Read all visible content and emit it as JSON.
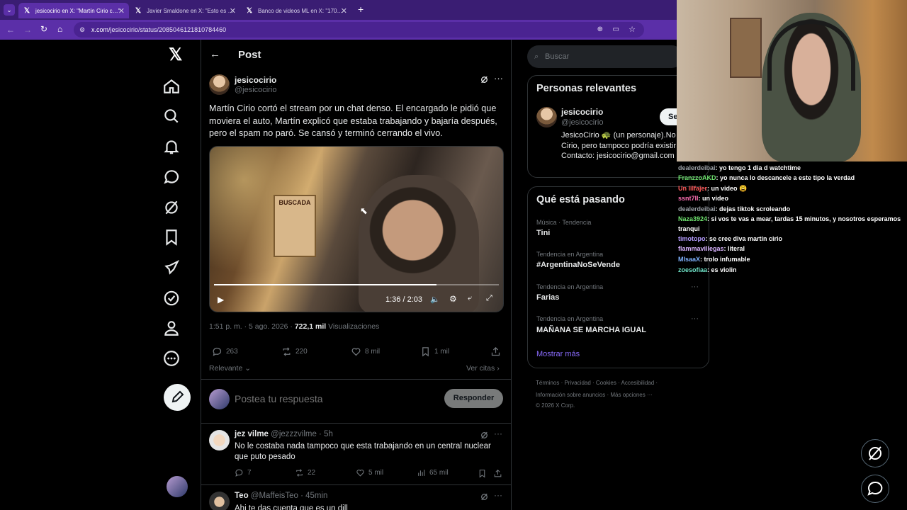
{
  "browser": {
    "tabs": [
      {
        "label": "jesicocirio en X: \"Martín Cirio c…\"",
        "active": true
      },
      {
        "label": "Javier Smaldone en X: \"Esto es …",
        "active": false
      },
      {
        "label": "Banco de videos ML en X: \"170…",
        "active": false
      }
    ],
    "url_host": "x.com",
    "url_path": "/jesicocirio/status/2085046121810784460"
  },
  "post": {
    "header_title": "Post",
    "author_name": "jesicocirio",
    "author_handle": "@jesicocirio",
    "text": "Martín Cirio cortó el stream por un chat denso. El encargado le pidió que moviera el auto, Martín explicó que estaba trabajando y bajaría después, pero el spam no paró. Se cansó y terminó cerrando el vivo.",
    "video_time": "1:36 / 2:03",
    "video_progress": 0.78,
    "video_sign": "BUSCADA",
    "meta_time": "1:51 p. m. · 5 ago. 2026 · ",
    "views_count": "722,1 mil",
    "views_label": " Visualizaciones",
    "replies": "263",
    "reposts": "220",
    "likes": "8 mil",
    "bookmarks": "1 mil",
    "sort_label": "Relevante",
    "quotes_link": "Ver citas",
    "reply_placeholder": "Postea tu respuesta",
    "reply_button": "Responder"
  },
  "replies": [
    {
      "name": "jez vilme",
      "handle": "@jezzzvilme · 5h",
      "text": "No le costaba nada tampoco que esta trabajando en un central nuclear que puto pesado",
      "replies": "7",
      "reposts": "22",
      "likes": "5 mil",
      "views": "65 mil"
    },
    {
      "name": "Teo",
      "handle": "@MaffeisTeo · 45min",
      "text": "Ahi te das cuenta que es un dill"
    }
  ],
  "sidebar": {
    "search_placeholder": "Buscar",
    "relevant_title": "Personas relevantes",
    "relevant_name": "jesicocirio",
    "relevant_handle": "@jesicocirio",
    "follow_button": "Se",
    "bio": "JesicoCirio 🐢 (un personaje).No Martín Cirio, pero tampoco podría existir sin él. Contacto: jesicocirio@gmail.com",
    "whats_title": "Qué está pasando",
    "trends": [
      {
        "category": "Música · Tendencia",
        "name": "Tini"
      },
      {
        "category": "Tendencia en Argentina",
        "name": "#ArgentinaNoSeVende"
      },
      {
        "category": "Tendencia en Argentina",
        "name": "Farias"
      },
      {
        "category": "Tendencia en Argentina",
        "name": "MAÑANA SE MARCHA IGUAL"
      }
    ],
    "show_more": "Mostrar más",
    "footer_line1": "Términos · Privacidad · Cookies · Accesibilidad ·",
    "footer_line2": "Información sobre anuncios · Más opciones ···",
    "footer_line3": "© 2026 X Corp."
  },
  "chat": [
    {
      "user": "dealerdeibai",
      "color": "#9aa0a6",
      "msg": ": yo tengo 1 dia d watchtime"
    },
    {
      "user": "FranzzoAKD",
      "color": "#6fe36f",
      "msg": ": yo nunca lo descancele a este tipo la verdad"
    },
    {
      "user": "Un lilfajer",
      "color": "#ff5a5a",
      "msg": ": un video 😩"
    },
    {
      "user": "ssnt7ll",
      "color": "#ff6fb3",
      "msg": ": un video"
    },
    {
      "user": "dealerdeibai",
      "color": "#9aa0a6",
      "msg": ": dejas tiktok scroleando"
    },
    {
      "user": "Naza3924",
      "color": "#6fe36f",
      "msg": ": si vos te vas a mear, tardas 15 minutos, y nosotros esperamos tranqui"
    },
    {
      "user": "timotopo",
      "color": "#b49cff",
      "msg": ": se cree diva martin cirio"
    },
    {
      "user": "flammavillegas",
      "color": "#d9b3ff",
      "msg": ": literal"
    },
    {
      "user": "MIsaaX",
      "color": "#7fb2ff",
      "msg": ": trolo infumable"
    },
    {
      "user": "zoesofiaa",
      "color": "#6fe3c8",
      "msg": ": es violin"
    }
  ],
  "colors": {
    "accent": "#1d9bf0",
    "link": "#8b6cff",
    "tab_bg": "#3a1d73",
    "addr_bg": "#5b2fa8"
  }
}
